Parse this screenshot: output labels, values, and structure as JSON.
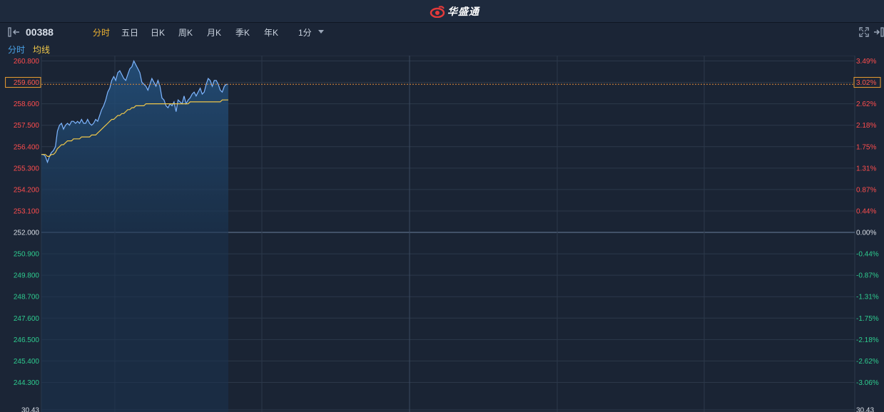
{
  "brand": {
    "name": "华盛通"
  },
  "toolbar": {
    "stock_code": "00388",
    "tabs": [
      {
        "label": "分时",
        "active": true
      },
      {
        "label": "五日",
        "active": false
      },
      {
        "label": "日K",
        "active": false
      },
      {
        "label": "周K",
        "active": false
      },
      {
        "label": "月K",
        "active": false
      },
      {
        "label": "季K",
        "active": false
      },
      {
        "label": "年K",
        "active": false
      }
    ],
    "interval": "1分"
  },
  "legend": {
    "price": "分时",
    "avg": "均线"
  },
  "colors": {
    "up": "#ff4d4d",
    "down": "#2ecc8f",
    "neutral": "#d9dee6",
    "price_line": "#7fb6ff",
    "avg_line": "#f0c84a",
    "area": "#1d3f66",
    "highlight_box": "#f0a030"
  },
  "chart_data": {
    "type": "line",
    "prev_close": 252.0,
    "ylim": [
      243.2,
      261.9
    ],
    "y_ticks": [
      "260.800",
      "259.600",
      "258.600",
      "257.500",
      "256.400",
      "255.300",
      "254.200",
      "253.100",
      "252.000",
      "250.900",
      "249.800",
      "248.700",
      "247.600",
      "246.500",
      "245.400",
      "244.300"
    ],
    "pct_ticks": [
      "3.49%",
      "3.02%",
      "2.62%",
      "2.18%",
      "1.75%",
      "1.31%",
      "0.87%",
      "0.44%",
      "0.00%",
      "-0.44%",
      "-0.87%",
      "-1.31%",
      "-1.75%",
      "-2.18%",
      "-2.62%",
      "-3.06%"
    ],
    "current_price": "259.600",
    "current_pct": "3.02%",
    "bottom_left_label": "30.43",
    "bottom_right_label": "30.43",
    "minutes_total": 330,
    "series": [
      {
        "key": "price",
        "values": [
          256.0,
          256.0,
          255.9,
          255.6,
          255.9,
          256.1,
          256.2,
          256.4,
          257.2,
          257.5,
          257.6,
          257.3,
          257.5,
          257.6,
          257.5,
          257.7,
          257.7,
          257.6,
          257.7,
          257.6,
          257.8,
          257.6,
          257.6,
          257.8,
          257.6,
          257.5,
          257.6,
          257.8,
          257.7,
          258.0,
          258.3,
          258.5,
          258.8,
          259.2,
          259.4,
          259.8,
          260.0,
          259.8,
          260.2,
          260.3,
          260.1,
          259.9,
          259.8,
          260.1,
          260.4,
          260.5,
          260.8,
          260.6,
          260.4,
          260.2,
          259.7,
          259.6,
          259.5,
          259.3,
          259.6,
          259.9,
          259.7,
          259.5,
          259.8,
          259.5,
          258.9,
          258.8,
          258.5,
          258.4,
          258.6,
          258.5,
          258.7,
          258.2,
          258.8,
          258.7,
          258.6,
          259.0,
          258.6,
          258.8,
          258.9,
          259.1,
          259.2,
          259.0,
          259.2,
          259.4,
          259.1,
          259.2,
          259.6,
          259.9,
          259.8,
          259.5,
          259.8,
          259.8,
          259.6,
          259.3,
          259.2,
          259.5,
          259.6,
          259.6
        ]
      },
      {
        "key": "avg",
        "values": [
          256.0,
          256.0,
          256.0,
          255.9,
          255.9,
          256.0,
          256.0,
          256.1,
          256.3,
          256.4,
          256.5,
          256.5,
          256.6,
          256.7,
          256.7,
          256.7,
          256.8,
          256.8,
          256.8,
          256.8,
          256.9,
          256.9,
          256.9,
          256.9,
          256.9,
          257.0,
          257.0,
          257.0,
          257.1,
          257.2,
          257.3,
          257.4,
          257.5,
          257.6,
          257.7,
          257.8,
          257.8,
          257.9,
          258.0,
          258.0,
          258.1,
          258.1,
          258.2,
          258.3,
          258.3,
          258.4,
          258.4,
          258.5,
          258.5,
          258.5,
          258.5,
          258.5,
          258.6,
          258.6,
          258.6,
          258.6,
          258.6,
          258.6,
          258.6,
          258.6,
          258.6,
          258.6,
          258.6,
          258.6,
          258.6,
          258.6,
          258.6,
          258.6,
          258.6,
          258.6,
          258.6,
          258.6,
          258.6,
          258.6,
          258.7,
          258.7,
          258.7,
          258.7,
          258.7,
          258.7,
          258.7,
          258.7,
          258.7,
          258.7,
          258.7,
          258.7,
          258.7,
          258.7,
          258.7,
          258.7,
          258.8,
          258.8,
          258.8,
          258.8
        ]
      }
    ]
  }
}
